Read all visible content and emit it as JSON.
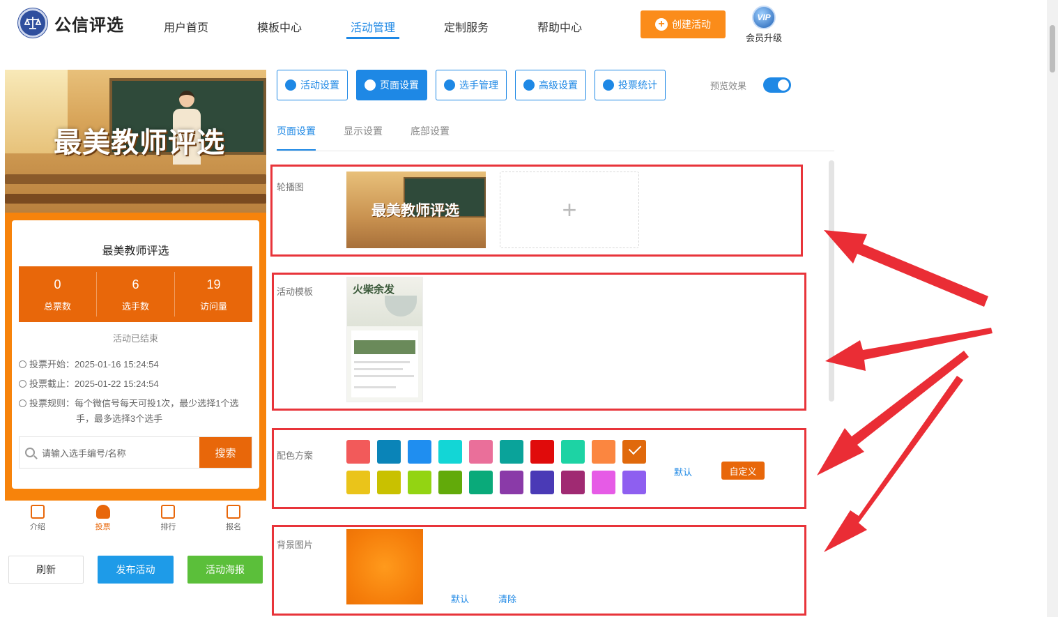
{
  "header": {
    "brand": "公信评选",
    "nav": [
      {
        "label": "用户首页"
      },
      {
        "label": "模板中心"
      },
      {
        "label": "活动管理"
      },
      {
        "label": "定制服务"
      },
      {
        "label": "帮助中心"
      }
    ],
    "active_nav": "活动管理",
    "create_button": "创建活动",
    "vip_badge": "VIP",
    "vip_label": "会员升级"
  },
  "preview": {
    "banner_title": "最美教师评选",
    "activity_title": "最美教师评选",
    "stats": [
      {
        "value": "0",
        "label": "总票数"
      },
      {
        "value": "6",
        "label": "选手数"
      },
      {
        "value": "19",
        "label": "访问量"
      }
    ],
    "status": "活动已结束",
    "vote_start": "投票开始：2025-01-16 15:24:54",
    "vote_end": "投票截止：2025-01-22 15:24:54",
    "rule_line1": "投票规则：每个微信号每天可投1次，最少选择1个选",
    "rule_line2": "手，最多选择3个选手",
    "search_placeholder": "请输入选手编号/名称",
    "search_button": "搜索",
    "tabs": [
      {
        "label": "介绍"
      },
      {
        "label": "投票"
      },
      {
        "label": "排行"
      },
      {
        "label": "报名"
      }
    ]
  },
  "actions": {
    "refresh": "刷新",
    "publish": "发布活动",
    "poster": "活动海报"
  },
  "toolbar": {
    "buttons": [
      {
        "label": "活动设置"
      },
      {
        "label": "页面设置"
      },
      {
        "label": "选手管理"
      },
      {
        "label": "高级设置"
      },
      {
        "label": "投票统计"
      }
    ],
    "preview_label": "预览效果",
    "preview_on": true
  },
  "subtabs": [
    {
      "label": "页面设置"
    },
    {
      "label": "显示设置"
    },
    {
      "label": "底部设置"
    }
  ],
  "settings": {
    "carousel_label": "轮播图",
    "carousel_thumb_title": "最美教师评选",
    "add_symbol": "+",
    "template_label": "活动模板",
    "template_thumb_title": "火柴余发",
    "color_label": "配色方案",
    "colors": [
      "#f25a5a",
      "#0a84b8",
      "#1f8ef0",
      "#13d6d6",
      "#ea6f9a",
      "#0aa39a",
      "#e00b0b",
      "#1dd3a4",
      "#fb8640",
      "#e0690c",
      "#eac41a",
      "#c9c100",
      "#93d412",
      "#62aa0a",
      "#0aaa7a",
      "#8a3aa8",
      "#4a3ab6",
      "#a02a72",
      "#e65be6",
      "#8e5ff0"
    ],
    "selected_color": "#e0690c",
    "color_default": "默认",
    "color_custom": "自定义",
    "bg_label": "背景图片",
    "bg_default": "默认",
    "bg_clear": "清除"
  },
  "accent_colors": {
    "primary": "#1e88e5",
    "orange": "#e8670a",
    "highlight_border": "#e8343a"
  }
}
